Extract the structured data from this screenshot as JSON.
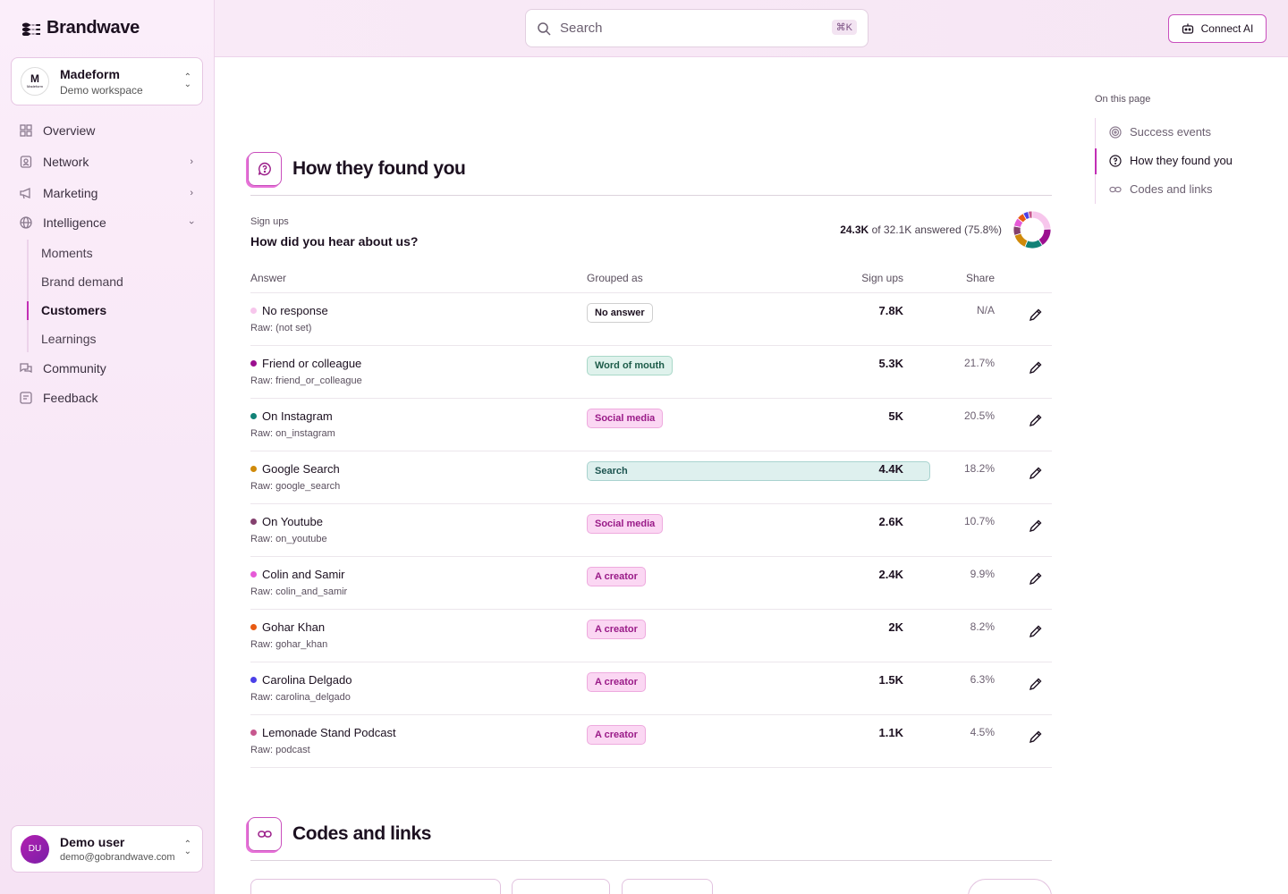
{
  "brand": {
    "name": "Brandwave"
  },
  "workspace": {
    "name": "Madeform",
    "subtitle": "Demo workspace",
    "logo_text": "Madeform"
  },
  "nav": {
    "overview": "Overview",
    "network": "Network",
    "marketing": "Marketing",
    "intelligence": "Intelligence",
    "sub": [
      "Moments",
      "Brand demand",
      "Customers",
      "Learnings"
    ],
    "community": "Community",
    "feedback": "Feedback"
  },
  "user": {
    "initials": "DU",
    "name": "Demo user",
    "email": "demo@gobrandwave.com"
  },
  "topbar": {
    "search_placeholder": "Search",
    "shortcut": "⌘K",
    "connect_label": "Connect AI"
  },
  "section": {
    "title": "How they found you",
    "label": "Sign ups",
    "question": "How did you hear about us?",
    "answered_count": "24.3K",
    "answered_rest": "of 32.1K answered (75.8%)",
    "columns": {
      "answer": "Answer",
      "grouped": "Grouped as",
      "signups": "Sign ups",
      "share": "Share"
    },
    "rows": [
      {
        "answer": "No response",
        "raw": "Raw: (not set)",
        "group": "No answer",
        "signups": "7.8K",
        "share": "N/A",
        "color": "#f7c6ec"
      },
      {
        "answer": "Friend or colleague",
        "raw": "Raw: friend_or_colleague",
        "group": "Word of mouth",
        "signups": "5.3K",
        "share": "21.7%",
        "color": "#9b0f8f"
      },
      {
        "answer": "On Instagram",
        "raw": "Raw: on_instagram",
        "group": "Social media",
        "signups": "5K",
        "share": "20.5%",
        "color": "#118277"
      },
      {
        "answer": "Google Search",
        "raw": "Raw: google_search",
        "group": "Search",
        "signups": "4.4K",
        "share": "18.2%",
        "color": "#d08a0a"
      },
      {
        "answer": "On Youtube",
        "raw": "Raw: on_youtube",
        "group": "Social media",
        "signups": "2.6K",
        "share": "10.7%",
        "color": "#84406e"
      },
      {
        "answer": "Colin and Samir",
        "raw": "Raw: colin_and_samir",
        "group": "A creator",
        "signups": "2.4K",
        "share": "9.9%",
        "color": "#e65ad7"
      },
      {
        "answer": "Gohar Khan",
        "raw": "Raw: gohar_khan",
        "group": "A creator",
        "signups": "2K",
        "share": "8.2%",
        "color": "#e85a12"
      },
      {
        "answer": "Carolina Delgado",
        "raw": "Raw: carolina_delgado",
        "group": "A creator",
        "signups": "1.5K",
        "share": "6.3%",
        "color": "#4b40e8"
      },
      {
        "answer": "Lemonade Stand Podcast",
        "raw": "Raw: podcast",
        "group": "A creator",
        "signups": "1.1K",
        "share": "4.5%",
        "color": "#c7578e"
      }
    ]
  },
  "rail": {
    "label": "On this page",
    "items": [
      "Success events",
      "How they found you",
      "Codes and links"
    ]
  },
  "codes": {
    "title": "Codes and links"
  }
}
